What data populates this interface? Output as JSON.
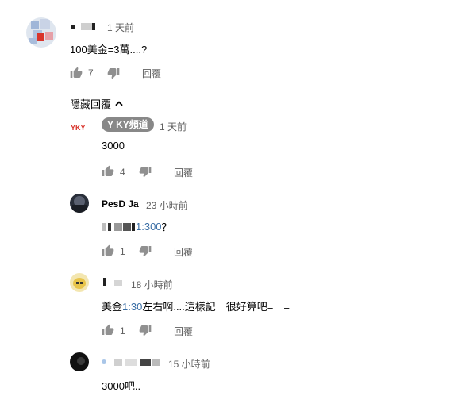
{
  "comments": [
    {
      "author": "",
      "time": "1 天前",
      "text": "100美金=3萬....?",
      "likes": "7",
      "reply_label": "回覆"
    }
  ],
  "hide_replies_label": "隱藏回覆",
  "replies": [
    {
      "author": "Y KY頻道",
      "time": "1 天前",
      "text": "3000",
      "likes": "4",
      "reply_label": "回覆"
    },
    {
      "author": "PesD Ja",
      "time": "23 小時前",
      "text_link": "1:300",
      "text_after": "？",
      "likes": "1",
      "reply_label": "回覆"
    },
    {
      "author": "",
      "time": "18 小時前",
      "text_before": "美金",
      "text_link": "1:30",
      "text_after": "左右啊....這樣記　很好算吧=　=",
      "likes": "1",
      "reply_label": "回覆"
    },
    {
      "author": "",
      "time": "15 小時前",
      "text": "3000吧.."
    }
  ],
  "colors": {
    "link": "#3a6ea5",
    "badge": "#888888",
    "meta": "#606060"
  },
  "icons": [
    "thumbs-up-icon",
    "thumbs-down-icon",
    "chevron-up-icon"
  ]
}
